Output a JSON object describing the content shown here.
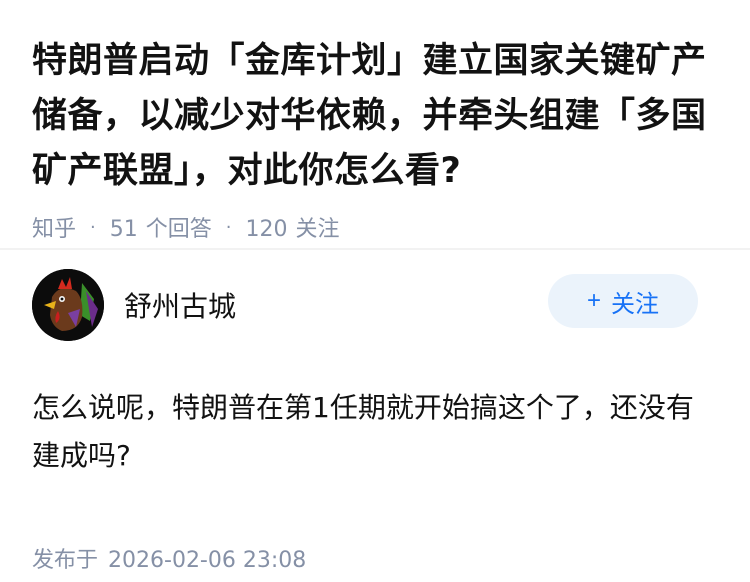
{
  "question": {
    "title": "特朗普启动「金库计划」建立国家关键矿产储备，以减少对华依赖，并牵头组建「多国矿产联盟」，对此你怎么看?",
    "source": "知乎",
    "answer_count": "51",
    "answer_label": "个回答",
    "follower_count": "120",
    "follower_label": "关注",
    "separator": "·"
  },
  "answer": {
    "author_name": "舒州古城",
    "follow_button": {
      "icon": "+",
      "label": "关注"
    },
    "content": "怎么说呢，特朗普在第1任期就开始搞这个了，还没有建成吗?",
    "publish_label": "发布于",
    "publish_time": "2026-02-06 23:08"
  },
  "colors": {
    "accent": "#1772f6",
    "follow_bg": "#ebf3fb",
    "meta_text": "#8590a6",
    "main_text": "#121212"
  }
}
